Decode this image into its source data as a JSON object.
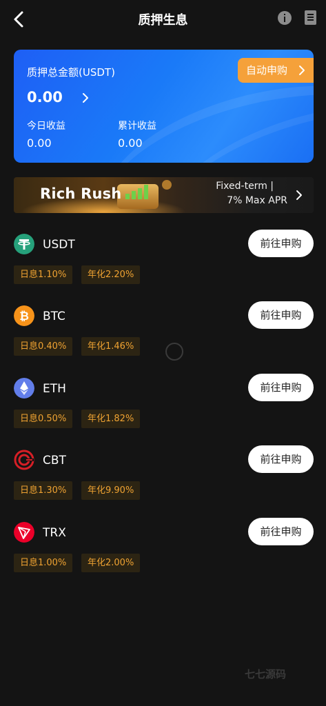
{
  "header": {
    "title": "质押生息"
  },
  "summary": {
    "label": "质押总金额(USDT)",
    "amount": "0.00",
    "auto_button": "自动申购",
    "today_label": "今日收益",
    "today_value": "0.00",
    "total_label": "累计收益",
    "total_value": "0.00"
  },
  "banner": {
    "title": "Rich Rush",
    "line1": "Fixed-term |",
    "line2": "7% Max APR"
  },
  "coins": [
    {
      "name": "USDT",
      "button": "前往申购",
      "daily": "日息1.10%",
      "annual": "年化2.20%",
      "color": "#26a17b"
    },
    {
      "name": "BTC",
      "button": "前往申购",
      "daily": "日息0.40%",
      "annual": "年化1.46%",
      "color": "#f7931a"
    },
    {
      "name": "ETH",
      "button": "前往申购",
      "daily": "日息0.50%",
      "annual": "年化1.82%",
      "color": "#627eea"
    },
    {
      "name": "CBT",
      "button": "前往申购",
      "daily": "日息1.30%",
      "annual": "年化9.90%",
      "color": "#d61f26"
    },
    {
      "name": "TRX",
      "button": "前往申购",
      "daily": "日息1.00%",
      "annual": "年化2.00%",
      "color": "#eb0029"
    }
  ],
  "watermark": "七七源码"
}
